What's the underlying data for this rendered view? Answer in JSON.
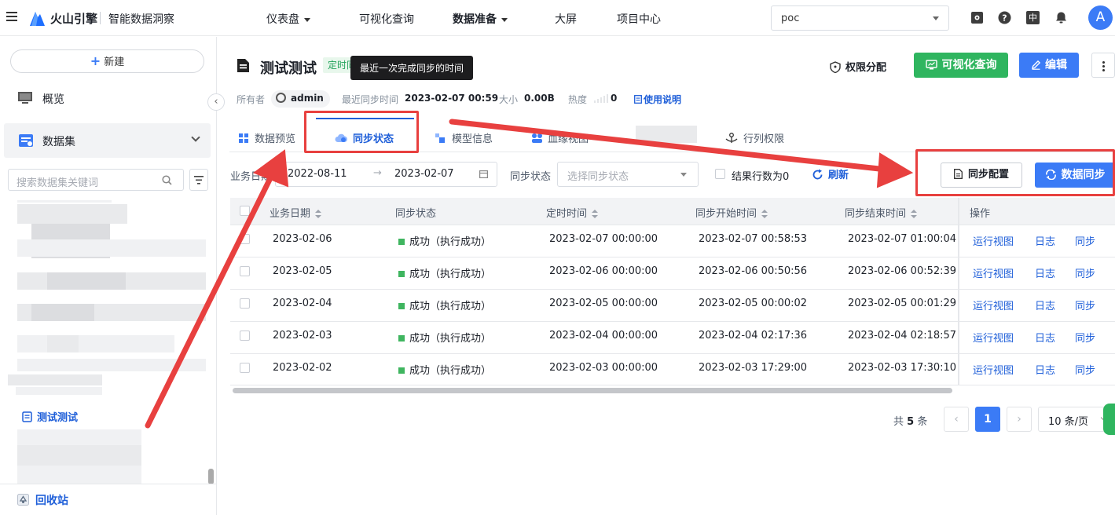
{
  "topbar": {
    "brand": "火山引擎",
    "product": "智能数据洞察",
    "nav": [
      {
        "label": "仪表盘",
        "dropdown": true
      },
      {
        "label": "可视化查询",
        "dropdown": false
      },
      {
        "label": "数据准备",
        "dropdown": true
      },
      {
        "label": "大屏",
        "dropdown": false
      },
      {
        "label": "项目中心",
        "dropdown": false
      }
    ],
    "project": "poc",
    "lang_badge": "中",
    "avatar_letter": "A"
  },
  "sidebar": {
    "new_label": "新建",
    "overview_label": "概览",
    "dataset_label": "数据集",
    "search_placeholder": "搜索数据集关键词",
    "active_dataset": "测试测试",
    "recycle_label": "回收站"
  },
  "header": {
    "title": "测试测试",
    "tag": "定时同步",
    "tooltip": "最近一次完成同步的时间",
    "permission_label": "权限分配",
    "visual_query_label": "可视化查询",
    "edit_label": "编辑",
    "owner_label": "所有者",
    "owner": "admin",
    "last_sync_label": "最近同步时间",
    "last_sync": "2023-02-07 00:59",
    "size_label": "大小",
    "size": "0.00B",
    "heat_label": "热度",
    "heat": "0",
    "help_label": "使用说明"
  },
  "tabs": [
    {
      "label": "数据预览",
      "active": false
    },
    {
      "label": "同步状态",
      "active": true
    },
    {
      "label": "模型信息",
      "active": false
    },
    {
      "label": "血缘视图",
      "active": false
    },
    {
      "label": "行列权限",
      "active": false
    }
  ],
  "filters": {
    "date_label": "业务日期",
    "date_start": "2022-08-11",
    "date_end": "2023-02-07",
    "status_label": "同步状态",
    "status_placeholder": "选择同步状态",
    "zero_rows_label": "结果行数为0",
    "refresh_label": "刷新",
    "sync_config_label": "同步配置",
    "data_sync_label": "数据同步"
  },
  "table": {
    "columns": [
      "业务日期",
      "同步状态",
      "定时时间",
      "同步开始时间",
      "同步结束时间",
      "操作"
    ],
    "rows": [
      {
        "date": "2023-02-06",
        "status": "成功（执行成功）",
        "scheduled": "2023-02-07 00:00:00",
        "start": "2023-02-07 00:58:53",
        "end": "2023-02-07 01:00:04"
      },
      {
        "date": "2023-02-05",
        "status": "成功（执行成功）",
        "scheduled": "2023-02-06 00:00:00",
        "start": "2023-02-06 00:50:56",
        "end": "2023-02-06 00:52:39"
      },
      {
        "date": "2023-02-04",
        "status": "成功（执行成功）",
        "scheduled": "2023-02-05 00:00:00",
        "start": "2023-02-05 00:00:02",
        "end": "2023-02-05 00:01:29"
      },
      {
        "date": "2023-02-03",
        "status": "成功（执行成功）",
        "scheduled": "2023-02-04 00:00:00",
        "start": "2023-02-04 02:17:36",
        "end": "2023-02-04 02:18:57"
      },
      {
        "date": "2023-02-02",
        "status": "成功（执行成功）",
        "scheduled": "2023-02-03 00:00:00",
        "start": "2023-02-03 17:29:00",
        "end": "2023-02-03 17:30:10"
      }
    ],
    "ops": [
      "运行视图",
      "日志",
      "同步"
    ]
  },
  "pager": {
    "total_prefix": "共",
    "total": "5",
    "total_suffix": "条",
    "page": "1",
    "page_size": "10 条/页"
  },
  "colors": {
    "primary": "#3b7bf6",
    "green": "#2fb55f",
    "annotation": "#e8403f"
  }
}
